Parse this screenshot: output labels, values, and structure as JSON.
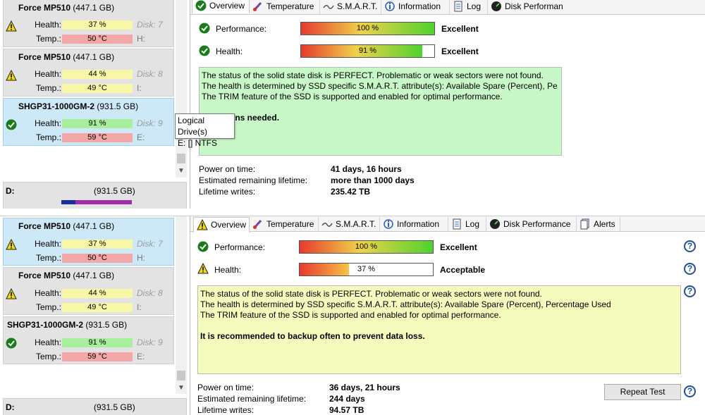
{
  "top": {
    "disks": [
      {
        "name": "Force MP510",
        "size": "(447.1 GB)",
        "health_label": "Health:",
        "health_value": "37 %",
        "health_color": "yellow",
        "disk_no": "Disk: 7",
        "temp_label": "Temp.:",
        "temp_value": "50 °C",
        "drive_letter": "H:",
        "status_icon": "warning-icon",
        "selected": false
      },
      {
        "name": "Force MP510",
        "size": "(447.1 GB)",
        "health_label": "Health:",
        "health_value": "44 %",
        "health_color": "yellow",
        "disk_no": "Disk: 8",
        "temp_label": "Temp.:",
        "temp_value": "49 °C",
        "drive_letter": "I:",
        "status_icon": "warning-icon",
        "selected": false
      },
      {
        "name": "SHGP31-1000GM-2",
        "size": "(931.5 GB)",
        "health_label": "Health:",
        "health_value": "91 %",
        "health_color": "green",
        "disk_no": "Disk: 9",
        "temp_label": "Temp.:",
        "temp_value": "59 °C",
        "drive_letter": "E:",
        "status_icon": "check-icon",
        "selected": true
      }
    ],
    "volume": {
      "letter": "D:",
      "size": "(931.5 GB)"
    },
    "tooltip": {
      "line1": "Logical Drive(s)",
      "line2": "E: [] NTFS"
    },
    "tabs": [
      "Overview",
      "Temperature",
      "S.M.A.R.T.",
      "Information",
      "Log",
      "Disk Performan"
    ],
    "performance": {
      "label": "Performance:",
      "value": "100 %",
      "percent": 100,
      "verdict": "Excellent",
      "icon": "check-icon"
    },
    "health": {
      "label": "Health:",
      "value": "91 %",
      "percent": 91,
      "verdict": "Excellent",
      "icon": "check-icon"
    },
    "message": {
      "lines": [
        "The status of the solid state disk is PERFECT. Problematic or weak sectors were not found.",
        "The health is determined by SSD specific S.M.A.R.T. attribute(s):  Available Spare (Percent), Pe",
        "The TRIM feature of the SSD is supported and enabled for optimal performance."
      ],
      "bold": "No actions needed.",
      "color": "#c8f7c8"
    },
    "stats": [
      {
        "label": "Power on time:",
        "value": "41 days, 16 hours"
      },
      {
        "label": "Estimated remaining lifetime:",
        "value": "more than 1000 days"
      },
      {
        "label": "Lifetime writes:",
        "value": "235.42 TB"
      }
    ]
  },
  "bottom": {
    "disks": [
      {
        "name": "Force MP510",
        "size": "(447.1 GB)",
        "health_label": "Health:",
        "health_value": "37 %",
        "health_color": "yellow",
        "disk_no": "Disk: 7",
        "temp_label": "Temp.:",
        "temp_value": "50 °C",
        "drive_letter": "H:",
        "status_icon": "warning-icon",
        "selected": true
      },
      {
        "name": "Force MP510",
        "size": "(447.1 GB)",
        "health_label": "Health:",
        "health_value": "44 %",
        "health_color": "yellow",
        "disk_no": "Disk: 8",
        "temp_label": "Temp.:",
        "temp_value": "49 °C",
        "drive_letter": "I:",
        "status_icon": "warning-icon",
        "selected": false
      },
      {
        "name": "SHGP31-1000GM-2",
        "size": "(931.5 GB)",
        "health_label": "Health:",
        "health_value": "91 %",
        "health_color": "green",
        "disk_no": "Disk: 9",
        "temp_label": "Temp.:",
        "temp_value": "59 °C",
        "drive_letter": "E:",
        "status_icon": "check-icon",
        "selected": false
      }
    ],
    "volume": {
      "letter": "D:",
      "size": "(931.5 GB)"
    },
    "tabs": [
      "Overview",
      "Temperature",
      "S.M.A.R.T.",
      "Information",
      "Log",
      "Disk Performance",
      "Alerts"
    ],
    "performance": {
      "label": "Performance:",
      "value": "100 %",
      "percent": 100,
      "verdict": "Excellent",
      "icon": "check-icon"
    },
    "health": {
      "label": "Health:",
      "value": "37 %",
      "percent": 37,
      "verdict": "Acceptable",
      "icon": "warning-icon"
    },
    "message": {
      "lines": [
        "The status of the solid state disk is PERFECT. Problematic or weak sectors were not found.",
        "The health is determined by SSD specific S.M.A.R.T. attribute(s):  Available Spare (Percent), Percentage Used",
        "The TRIM feature of the SSD is supported and enabled for optimal performance."
      ],
      "bold": "It is recommended to backup often to prevent data loss.",
      "color": "#f5fbbd"
    },
    "stats": [
      {
        "label": "Power on time:",
        "value": "36 days, 21 hours"
      },
      {
        "label": "Estimated remaining lifetime:",
        "value": "244 days"
      },
      {
        "label": "Lifetime writes:",
        "value": "94.57 TB"
      }
    ],
    "repeat_button": "Repeat Test",
    "help_glyph": "?"
  }
}
